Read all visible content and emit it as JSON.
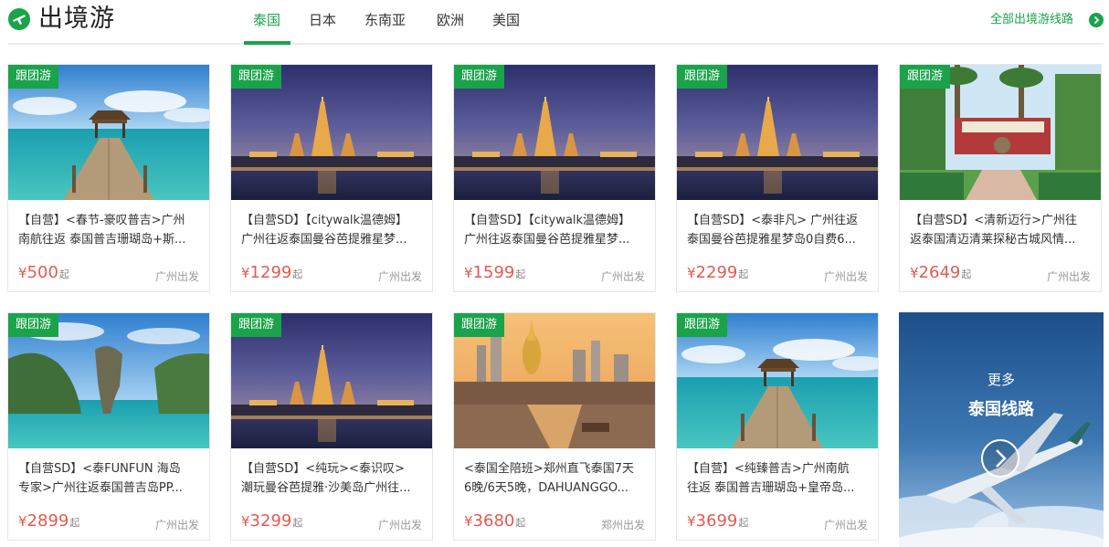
{
  "header": {
    "title": "出境游",
    "tabs": [
      {
        "label": "泰国",
        "active": true
      },
      {
        "label": "日本",
        "active": false
      },
      {
        "label": "东南亚",
        "active": false
      },
      {
        "label": "欧洲",
        "active": false
      },
      {
        "label": "美国",
        "active": false
      }
    ],
    "all_link": "全部出境游线路",
    "icons": {
      "logo": "airplane-circle-icon",
      "all_link": "chevron-right-circle-icon"
    }
  },
  "colors": {
    "accent": "#1aa34a",
    "price": "#e55a50"
  },
  "cards": [
    {
      "badge": "跟团游",
      "title_line1": "【自营】<春节-豪叹普吉>广州",
      "title_line2": "南航往返 泰国普吉珊瑚岛+斯...",
      "price_symbol": "¥",
      "price": "500",
      "price_suffix": "起",
      "depart": "广州出发",
      "image": "pier-sea-photo"
    },
    {
      "badge": "跟团游",
      "title_line1": "【自营SD】【citywalk温德姆】",
      "title_line2": "广州往返泰国曼谷芭提雅星梦...",
      "price_symbol": "¥",
      "price": "1299",
      "price_suffix": "起",
      "depart": "广州出发",
      "image": "temple-night-photo"
    },
    {
      "badge": "跟团游",
      "title_line1": "【自营SD】【citywalk温德姆】",
      "title_line2": "广州往返泰国曼谷芭提雅星梦...",
      "price_symbol": "¥",
      "price": "1599",
      "price_suffix": "起",
      "depart": "广州出发",
      "image": "temple-night-photo"
    },
    {
      "badge": "跟团游",
      "title_line1": "【自营SD】<泰非凡> 广州往返",
      "title_line2": "泰国曼谷芭提雅星梦岛0自费6...",
      "price_symbol": "¥",
      "price": "2299",
      "price_suffix": "起",
      "depart": "广州出发",
      "image": "temple-night-photo"
    },
    {
      "badge": "跟团游",
      "title_line1": "【自营SD】<清新迈行>广州往",
      "title_line2": "返泰国清迈清莱探秘古城风情...",
      "price_symbol": "¥",
      "price": "2649",
      "price_suffix": "起",
      "depart": "广州出发",
      "image": "chiangmai-gate-photo"
    },
    {
      "badge": "跟团游",
      "title_line1": "【自营SD】<泰FUNFUN 海岛",
      "title_line2": "专家>广州往返泰国普吉岛PP...",
      "price_symbol": "¥",
      "price": "2899",
      "price_suffix": "起",
      "depart": "广州出发",
      "image": "karst-island-photo"
    },
    {
      "badge": "跟团游",
      "title_line1": "【自营SD】<纯玩><泰识叹>",
      "title_line2": "潮玩曼谷芭提雅·沙美岛广州往...",
      "price_symbol": "¥",
      "price": "3299",
      "price_suffix": "起",
      "depart": "广州出发",
      "image": "temple-night-photo"
    },
    {
      "badge": "跟团游",
      "title_line1": "<泰国全陪班>郑州直飞泰国7天",
      "title_line2": "6晚/6天5晚，DAHUANGGO...",
      "price_symbol": "¥",
      "price": "3680",
      "price_suffix": "起",
      "depart": "郑州出发",
      "image": "bangkok-canal-photo"
    },
    {
      "badge": "跟团游",
      "title_line1": "【自营】<纯臻普吉>广州南航",
      "title_line2": "往返 泰国普吉珊瑚岛+皇帝岛...",
      "price_symbol": "¥",
      "price": "3699",
      "price_suffix": "起",
      "depart": "广州出发",
      "image": "pier-sea-photo"
    }
  ],
  "more_card": {
    "line1": "更多",
    "line2": "泰国线路",
    "icon": "chevron-right-circle-icon",
    "image": "airplane-clouds-photo"
  }
}
